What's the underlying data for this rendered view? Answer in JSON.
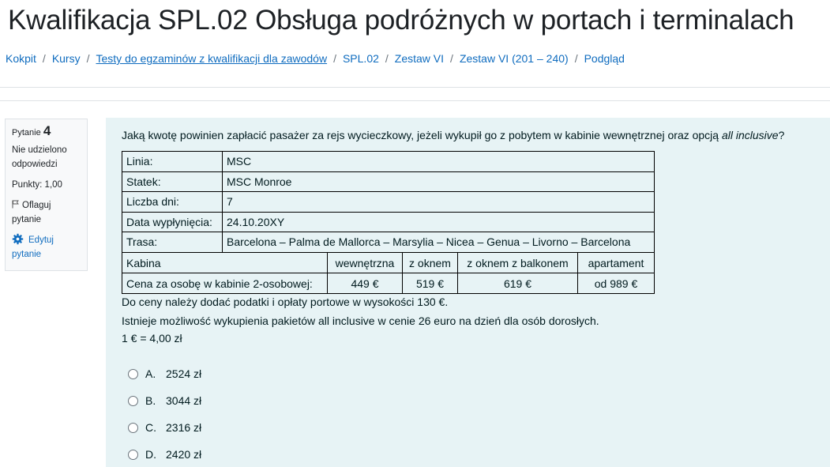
{
  "page": {
    "title": "Kwalifikacja SPL.02 Obsługa podróżnych w portach i terminalach"
  },
  "breadcrumb": [
    "Kokpit",
    "Kursy",
    "Testy do egzaminów z kwalifikacji dla zawodów",
    "SPL.02",
    "Zestaw VI",
    "Zestaw VI (201 – 240)",
    "Podgląd"
  ],
  "question_info": {
    "label": "Pytanie",
    "number": "4",
    "state": "Nie udzielono odpowiedzi",
    "grade": "Punkty: 1,00",
    "flag": "Oflaguj pytanie",
    "edit": "Edytuj pytanie"
  },
  "question": {
    "text_before": "Jaką kwotę powinien zapłacić pasażer za rejs wycieczkowy, jeżeli wykupił go z pobytem w kabinie wewnętrznej oraz opcją ",
    "text_em": "all inclusive",
    "text_after": "?",
    "details": [
      {
        "key": "Linia:",
        "value": "MSC"
      },
      {
        "key": "Statek:",
        "value": "MSC Monroe"
      },
      {
        "key": "Liczba dni:",
        "value": "7"
      },
      {
        "key": "Data wypłynięcia:",
        "value": "24.10.20XY"
      },
      {
        "key": "Trasa:",
        "value": "Barcelona – Palma de Mallorca – Marsylia – Nicea – Genua – Livorno – Barcelona"
      }
    ],
    "cabins": {
      "header": [
        "Kabina",
        "wewnętrzna",
        "z oknem",
        "z oknem z balkonem",
        "apartament"
      ],
      "row": [
        "Cena za osobę w kabinie 2-osobowej:",
        "449 €",
        "519 €",
        "619 €",
        "od 989 €"
      ]
    },
    "notes": [
      "Do ceny należy dodać podatki i opłaty portowe w wysokości 130 €.",
      "Istnieje możliwość wykupienia pakietów all inclusive w cenie 26 euro na dzień dla osób dorosłych.",
      "1 € = 4,00 zł"
    ]
  },
  "answers": [
    {
      "letter": "A.",
      "text": "2524 zł"
    },
    {
      "letter": "B.",
      "text": "3044 zł"
    },
    {
      "letter": "C.",
      "text": "2316 zł"
    },
    {
      "letter": "D.",
      "text": "2420 zł"
    }
  ],
  "colors": {
    "link": "#0f6cbf",
    "formulation_bg": "#e7f3f5",
    "info_bg": "#f8f9fa"
  }
}
